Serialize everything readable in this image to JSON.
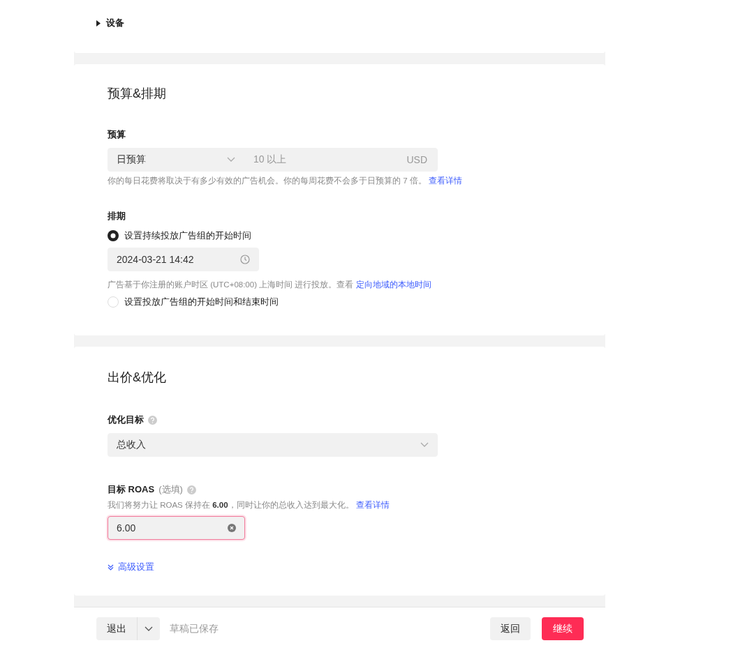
{
  "device_section": {
    "label": "设备",
    "expanded": false
  },
  "budget_schedule": {
    "title": "预算&排期",
    "budget": {
      "label": "预算",
      "type_select": "日预算",
      "amount_placeholder": "10 以上",
      "currency": "USD",
      "hint": "你的每日花费将取决于有多少有效的广告机会。你的每周花费不会多于日预算的 7 倍。",
      "hint_link": "查看详情"
    },
    "schedule": {
      "label": "排期",
      "options": [
        {
          "label": "设置持续投放广告组的开始时间",
          "selected": true,
          "start_time": "2024-03-21 14:42",
          "note": "广告基于你注册的账户时区 (UTC+08:00) 上海时间 进行投放。查看",
          "note_link": "定向地域的本地时间"
        },
        {
          "label": "设置投放广告组的开始时间和结束时间",
          "selected": false
        }
      ]
    }
  },
  "bidding": {
    "title": "出价&优化",
    "goal": {
      "label": "优化目标",
      "value": "总收入"
    },
    "roas": {
      "label": "目标 ROAS",
      "optional": "(选填)",
      "hint": "我们将努力让 ROAS 保持在 **6.00**，同时让你的总收入达到最大化。",
      "hint_link": "查看详情",
      "value": "6.00",
      "focused": true
    },
    "advanced": {
      "label": "高级设置",
      "expanded": false
    }
  },
  "footer": {
    "exit": "退出",
    "status": "草稿已保存",
    "back": "返回",
    "continue": "继续"
  }
}
